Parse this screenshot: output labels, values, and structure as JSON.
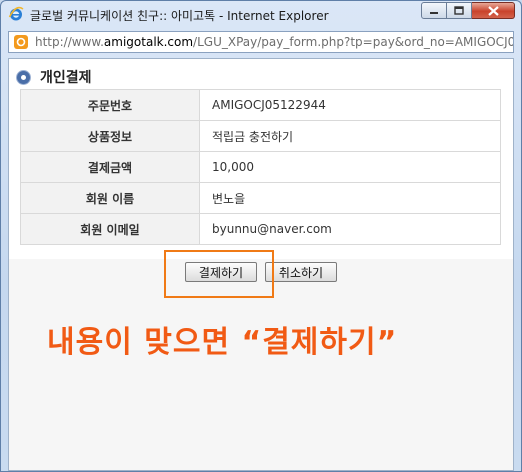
{
  "window": {
    "title": "글로벌 커뮤니케이션 친구:: 아미고톡 - Internet Explorer",
    "url_prefix": "http://www.",
    "url_domain": "amigotalk.com",
    "url_rest": "/LGU_XPay/pay_form.php?tp=pay&ord_no=AMIGOCJ05122944"
  },
  "section": {
    "title": "개인결제"
  },
  "rows": [
    {
      "label": "주문번호",
      "value": "AMIGOCJ05122944"
    },
    {
      "label": "상품정보",
      "value": "적립금 충전하기"
    },
    {
      "label": "결제금액",
      "value": "10,000"
    },
    {
      "label": "회원 이름",
      "value": "변노을"
    },
    {
      "label": "회원 이메일",
      "value": "byunnu@naver.com"
    }
  ],
  "buttons": {
    "pay": "결제하기",
    "cancel": "취소하기"
  },
  "annotation": "내용이 맞으면 “결제하기”",
  "colors": {
    "annotation": "#f15a14",
    "highlight": "#f07a16",
    "close_button": "#c9432c"
  }
}
